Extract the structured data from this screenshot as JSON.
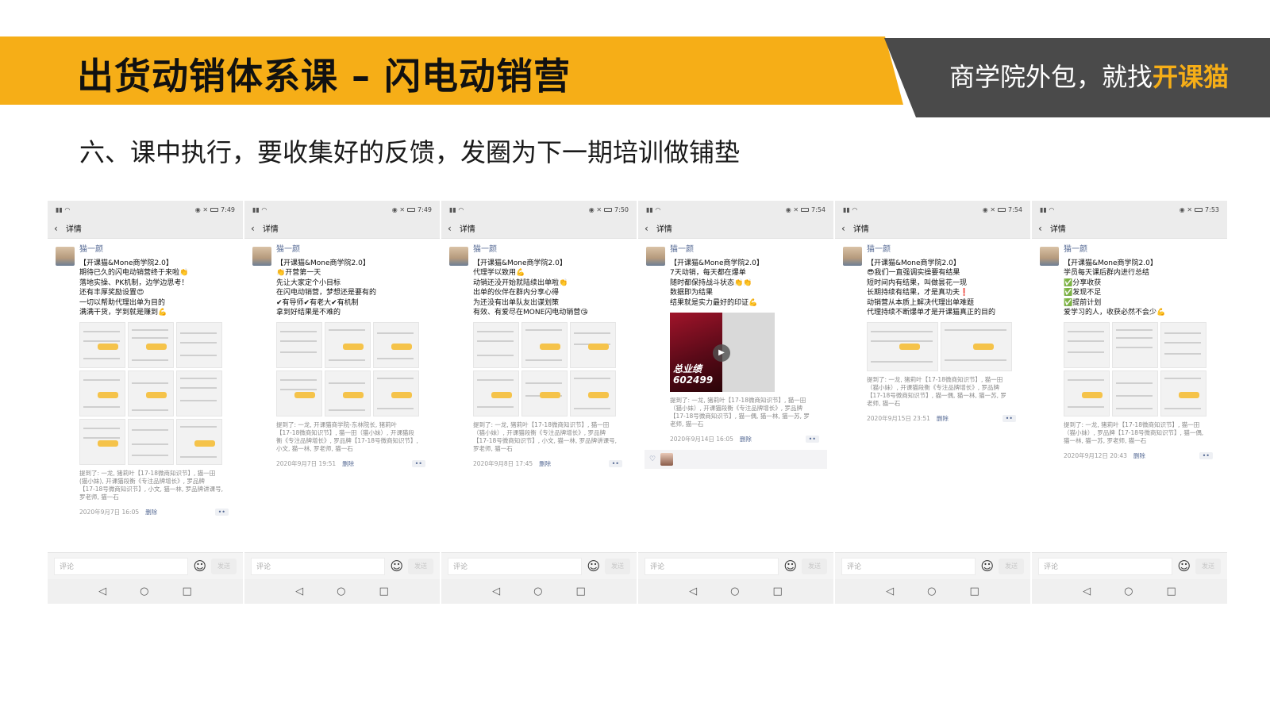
{
  "header": {
    "title": "出货动销体系课 – 闪电动销营",
    "tagline_prefix": "商学院外包，就找",
    "tagline_brand": "开课猫",
    "brand_color": "#f6ae17",
    "dark_color": "#4a4a4a"
  },
  "subtitle": "六、课中执行，要收集好的反馈，发圈为下一期培训做铺垫",
  "phones": [
    {
      "time": "7:49",
      "nav_title": "详情",
      "author": "猫一颜",
      "text": "【开课猫&Mone商学院2.0】\n期待已久的闪电动销营终于来啦👏\n落地实操、PK机制，边学边思考！\n还有丰厚奖励设置😍\n一切以帮助代理出单为目的\n满满干货，学到就是赚到💪",
      "mention": "提到了: 一龙, 猪莉叶【17-18微商知识节】, 猫一田\n(猫小妹), 开课猫段衡《专注品牌增长》, 罗品牌\n【17-18号微商知识节】, 小文, 猫一林, 罗品牌讲课号,\n罗老师, 猫一石",
      "date": "2020年9月7日 16:05",
      "delete": "删除",
      "comment_placeholder": "评论",
      "send": "发送"
    },
    {
      "time": "7:49",
      "nav_title": "详情",
      "author": "猫一颜",
      "text": "【开课猫&Mone商学院2.0】\n👏开营第一天\n先让大家定个小目标\n在闪电动销营，梦想还是要有的\n✔有导师✔有老大✔有机制\n拿到好结果是不难的",
      "mention": "提到了: 一龙, 开课猫商学院-东林院长, 猪莉叶\n【17-18微商知识节】, 猫一田（猫小妹）, 开课猫段\n衡《专注品牌增长》, 罗品牌【17-18号微商知识节】,\n小文, 猫一林, 罗老师, 猫一石",
      "date": "2020年9月7日 19:51",
      "delete": "删除",
      "comment_placeholder": "评论",
      "send": "发送"
    },
    {
      "time": "7:50",
      "nav_title": "详情",
      "author": "猫一颜",
      "text": "【开课猫&Mone商学院2.0】\n代理学以致用💪\n动销还没开始就陆续出单啦👏\n出单的伙伴在群内分享心得\n为还没有出单队友出谋划策\n有效、有爱尽在MONE闪电动销营😘",
      "mention": "提到了: 一龙, 猪莉叶【17-18微商知识节】, 猫一田\n（猫小妹）, 开课猫段衡《专注品牌增长》, 罗品牌\n【17-18号微商知识节】, 小文, 猫一林, 罗品牌讲课号,\n罗老师, 猫一石",
      "date": "2020年9月8日 17:45",
      "delete": "删除",
      "comment_placeholder": "评论",
      "send": "发送"
    },
    {
      "time": "7:54",
      "nav_title": "详情",
      "author": "猫一颜",
      "text": "【开课猫&Mone商学院2.0】\n7天动销，每天都在爆单\n随时都保持战斗状态👏👏\n数据即为结果\n结果就是实力最好的印证💪",
      "video_caption": "总业绩\n602499",
      "mention": "提到了: 一龙, 猪莉叶【17-18微商知识节】, 猫一田\n（猫小妹）, 开课猫段衡《专注品牌增长》, 罗品牌\n【17-18号微商知识节】, 猫一偶, 猫一林, 猫一苏, 罗\n老师, 猫一石",
      "date": "2020年9月14日 16:05",
      "delete": "删除",
      "comment_placeholder": "评论",
      "send": "发送"
    },
    {
      "time": "7:54",
      "nav_title": "详情",
      "author": "猫一颜",
      "text": "【开课猫&Mone商学院2.0】\n😎我们一直强调实操要有结果\n短时间内有结果，叫做昙花一现\n长期持续有结果，才是真功夫❗\n动销营从本质上解决代理出单难题\n代理持续不断爆单才是开课猫真正的目的",
      "mention": "提到了: 一龙, 猪莉叶【17-18微商知识节】, 猫一田\n（猫小妹）, 开课猫段衡《专注品牌增长》, 罗品牌\n【17-18号微商知识节】, 猫一偶, 猫一林, 猫一苏, 罗\n老师, 猫一石",
      "date": "2020年9月15日 23:51",
      "delete": "删除",
      "comment_placeholder": "评论",
      "send": "发送"
    },
    {
      "time": "7:53",
      "nav_title": "详情",
      "author": "猫一颜",
      "text": "【开课猫&Mone商学院2.0】\n学员每天课后群内进行总结\n✅分享收获\n✅发现不足\n✅提前计划\n爱学习的人，收获必然不会少💪",
      "mention": "提到了: 一龙, 猪莉叶【17-18微商知识节】, 猫一田\n（猫小妹）, 罗品牌【17-18号微商知识节】, 猫一偶,\n猫一林, 猫一苏, 罗老师, 猫一石",
      "date": "2020年9月12日 20:43",
      "delete": "删除",
      "comment_placeholder": "评论",
      "send": "发送"
    }
  ]
}
